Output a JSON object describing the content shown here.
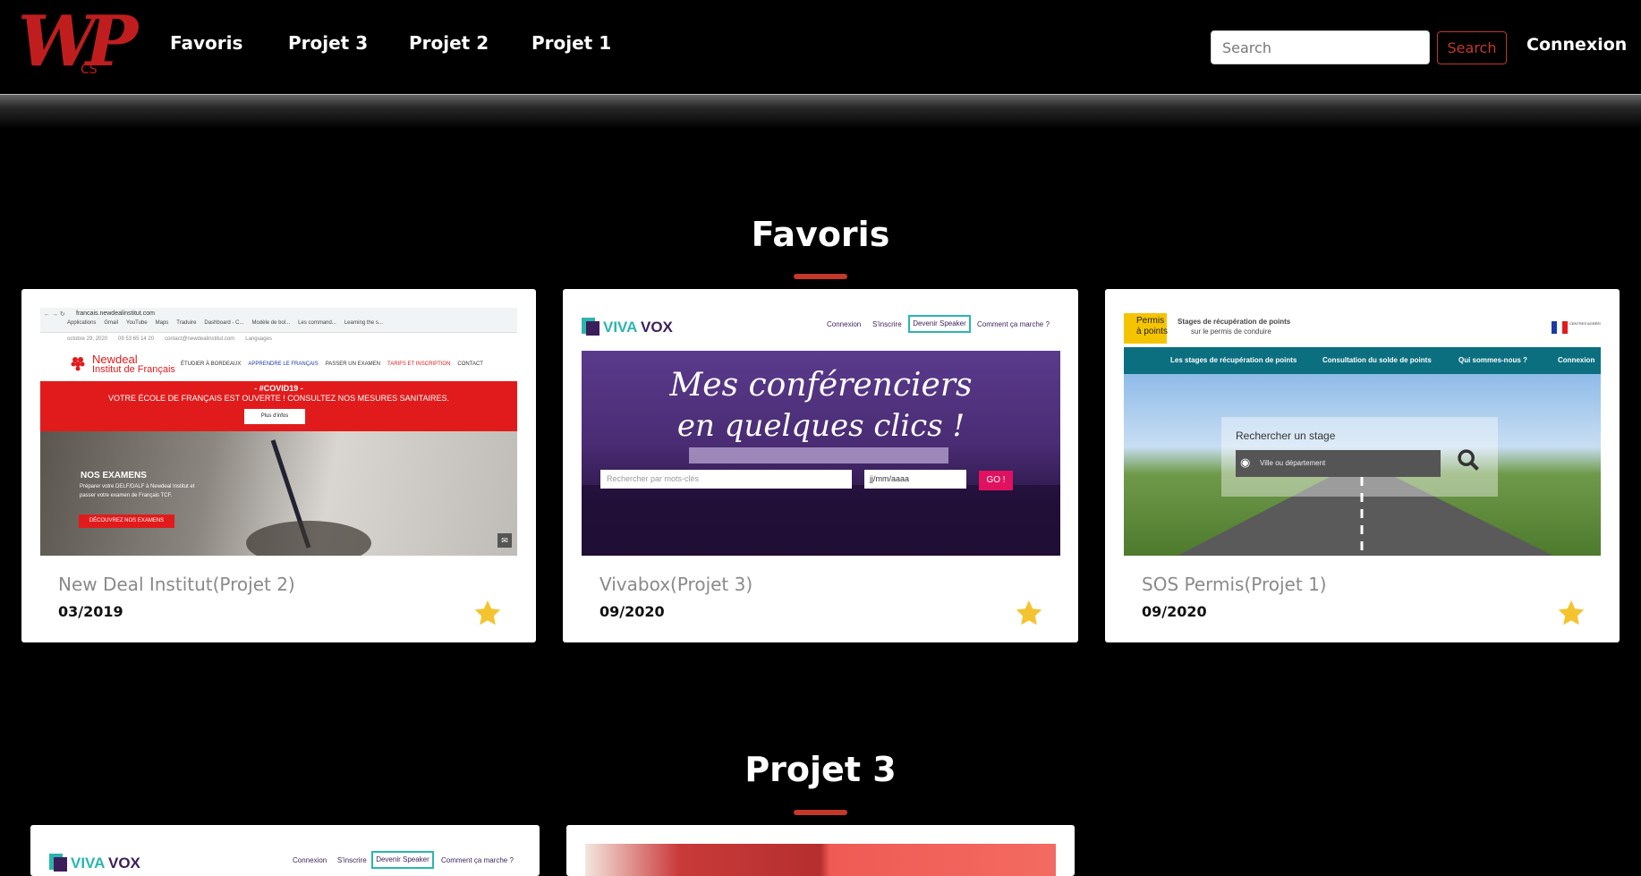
{
  "nav": {
    "logo_text": "WP",
    "logo_sub": "CS",
    "links": [
      "Favoris",
      "Projet 3",
      "Projet 2",
      "Projet 1"
    ],
    "search_placeholder": "Search",
    "search_button": "Search",
    "connexion": "Connexion"
  },
  "sections": {
    "favoris_title": "Favoris",
    "projet3_title": "Projet 3"
  },
  "cards": [
    {
      "title": "New Deal Institut(Projet 2)",
      "date": "03/2019",
      "shot": {
        "url": "francais.newdealinstitut.com",
        "bookmarks": [
          "Applications",
          "Gmail",
          "YouTube",
          "Maps",
          "Traduire",
          "Dashboard - C...",
          "Modèle de bol...",
          "Les command...",
          "Learning the s..."
        ],
        "date_line": "octobre 29, 2020",
        "phone": "09 53 65 14 20",
        "email": "contact@newdealinstitut.com",
        "languages": "Languages",
        "brand1": "Newdeal",
        "brand2": "Institut de Français",
        "menu": [
          "ÉTUDIER À BORDEAUX",
          "APPRENDRE LE FRANÇAIS",
          "PASSER UN EXAMEN",
          "TARIFS ET INSCRIPTION",
          "CONTACT"
        ],
        "covid_title": "- #COVID19 -",
        "covid_text": "VOTRE ÉCOLE DE FRANÇAIS EST OUVERTE ! CONSULTEZ NOS MESURES SANITAIRES.",
        "covid_btn": "Plus d'infos",
        "exam_title": "NOS EXAMENS",
        "exam_text1": "Préparer votre DELF/DALF à Newdeal Institut et",
        "exam_text2": "passer votre examen de Français TCF.",
        "exam_btn": "DÉCOUVREZ NOS EXAMENS"
      }
    },
    {
      "title": "Vivabox(Projet 3)",
      "date": "09/2020",
      "shot": {
        "brand_a": "VIVA",
        "brand_b": "VOX",
        "menu": [
          "Connexion",
          "S'inscrire",
          "Devenir Speaker",
          "Comment ça marche ?"
        ],
        "hero1": "Mes conférenciers",
        "hero2": "en quelques clics !",
        "search_placeholder": "Rechercher par mots-clés",
        "date_placeholder": "jj/mm/aaaa",
        "go": "GO !"
      }
    },
    {
      "title": "SOS Permis(Projet 1)",
      "date": "09/2020",
      "shot": {
        "brand1": "Permis",
        "brand2": "à points",
        "tagline1": "Stages de récupération de points",
        "tagline2": "sur le permis de conduire",
        "badge": "CENTRES AGRÉÉS PAR LES PRÉFECTURES",
        "menu": [
          "Les stages de récupération de points",
          "Consultation du solde de points",
          "Qui sommes-nous ?",
          "Connexion"
        ],
        "search_title": "Rechercher un stage",
        "search_placeholder": "Ville ou département"
      }
    }
  ],
  "projet3_cards": [
    {
      "shot": {
        "brand_a": "VIVA",
        "brand_b": "VOX",
        "menu": [
          "Connexion",
          "S'inscrire",
          "Devenir Speaker",
          "Comment ça marche ?"
        ]
      }
    },
    {
      "shot": {}
    }
  ],
  "colors": {
    "accent": "#c0392b",
    "logo": "#c01e1e",
    "star": "#f4c430",
    "vivavox_teal": "#2bb5b0",
    "vivavox_purple": "#3b1f5a",
    "newdeal_red": "#e11b1b",
    "permis_teal": "#0b6f80"
  }
}
